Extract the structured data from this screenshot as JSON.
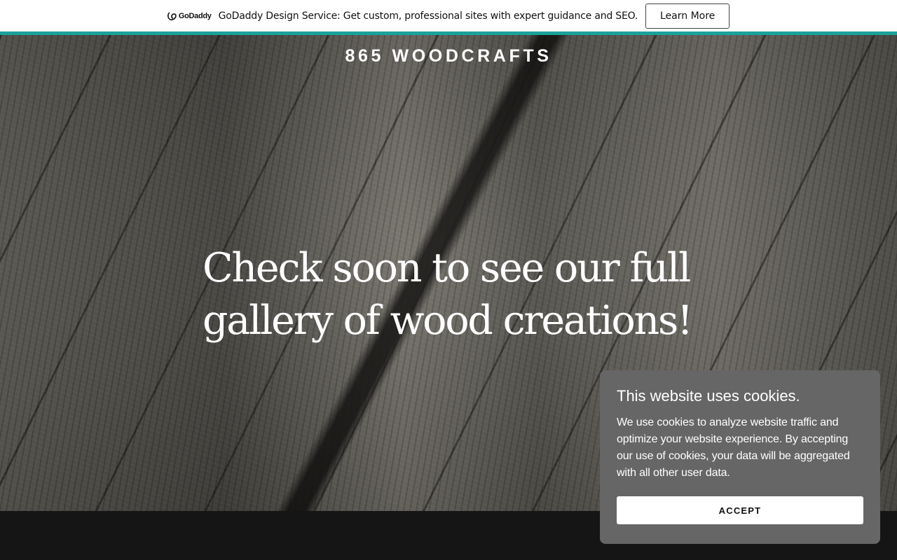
{
  "promo_bar": {
    "logo_text": "GoDaddy",
    "logo_icon": "godaddy-logo-icon",
    "message": "GoDaddy Design Service: Get custom, professional sites with expert guidance and SEO.",
    "button_label": "Learn More",
    "accent_color": "#1aa39b"
  },
  "hero": {
    "site_title": "865 WOODCRAFTS",
    "headline": "Check soon to see our full gallery of wood creations!"
  },
  "cookie_banner": {
    "title": "This website uses cookies.",
    "body": "We use cookies to analyze website traffic and optimize your website experience. By accepting our use of cookies, your data will be aggregated with all other user data.",
    "accept_label": "ACCEPT",
    "background_color": "#666666"
  }
}
